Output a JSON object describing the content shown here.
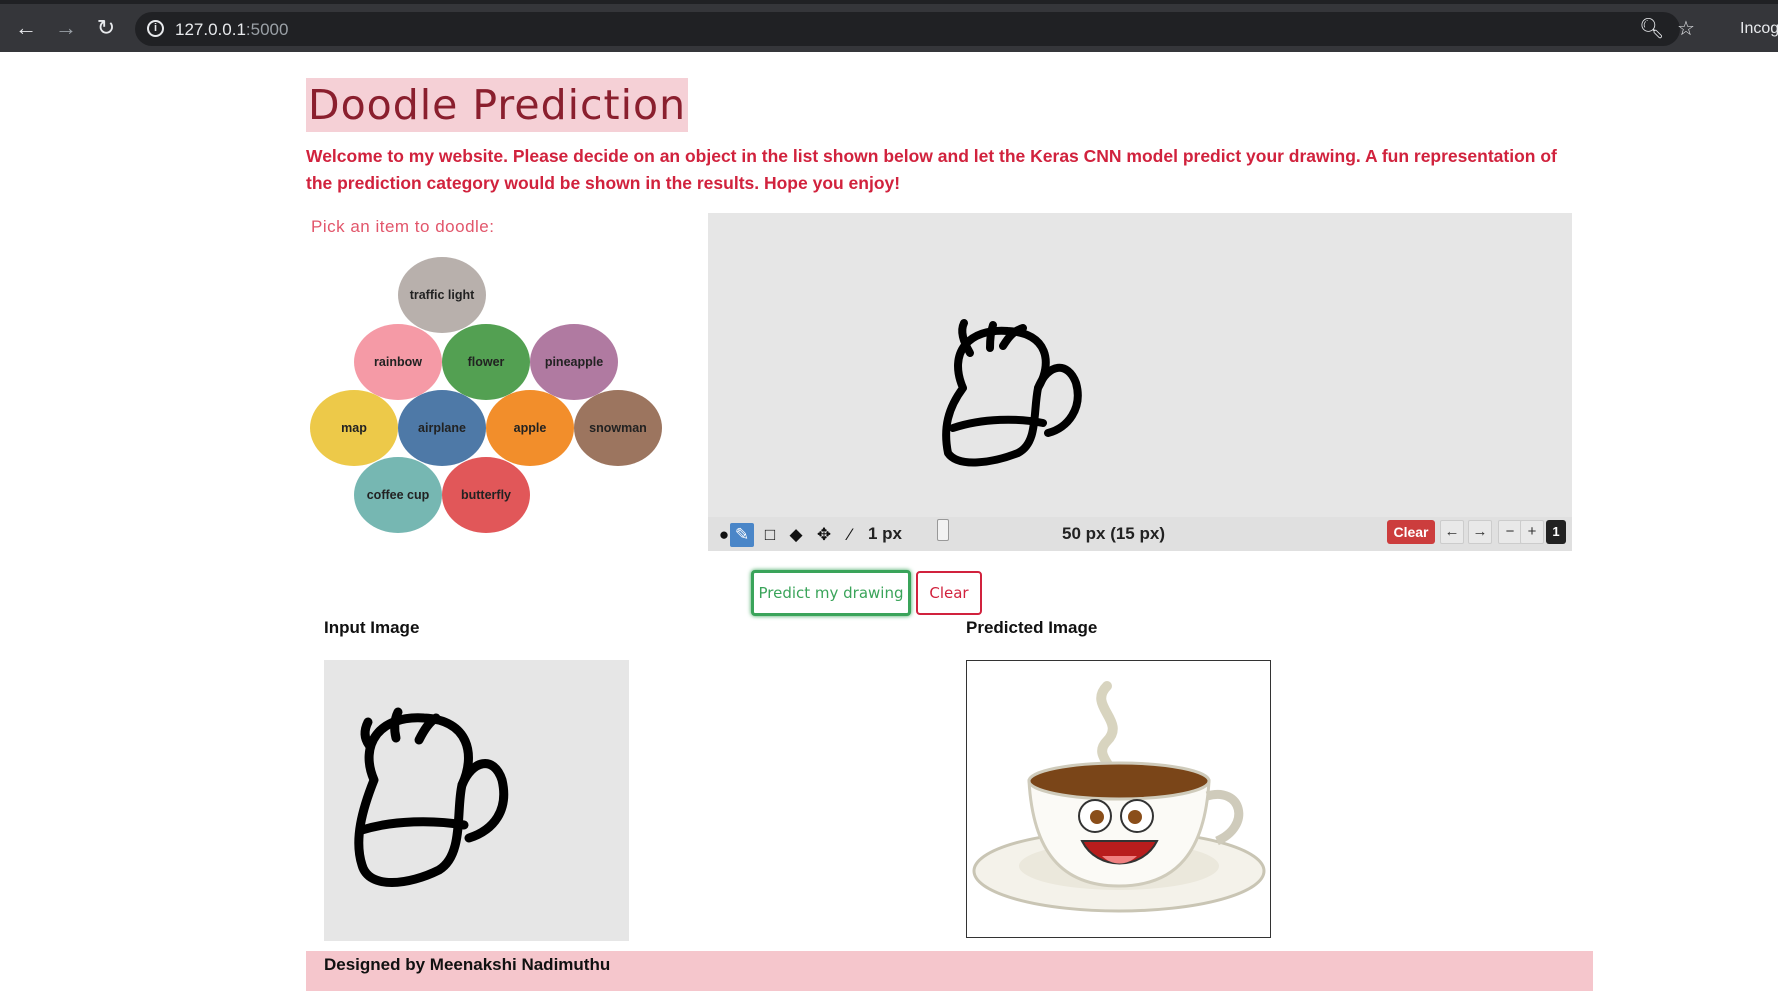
{
  "browser": {
    "url_host": "127.0.0.1",
    "url_port": ":5000",
    "incognito_label": "Incog"
  },
  "page": {
    "title": "Doodle Prediction",
    "welcome": "Welcome to my website. Please decide on an object in the list shown below and let the Keras CNN model predict your drawing. A fun representation of the prediction category would be shown in the results. Hope you enjoy!",
    "pick_label": "Pick an item to doodle:"
  },
  "items": [
    {
      "label": "traffic light",
      "color": "#b8b0ac"
    },
    {
      "label": "rainbow",
      "color": "#f59aa6"
    },
    {
      "label": "flower",
      "color": "#53a052"
    },
    {
      "label": "pineapple",
      "color": "#b07aa1"
    },
    {
      "label": "map",
      "color": "#edc949"
    },
    {
      "label": "airplane",
      "color": "#4e79a7"
    },
    {
      "label": "apple",
      "color": "#f28e2b"
    },
    {
      "label": "snowman",
      "color": "#9c755f"
    },
    {
      "label": "coffee cup",
      "color": "#76b7b2"
    },
    {
      "label": "butterfly",
      "color": "#e15759"
    }
  ],
  "toolbar": {
    "brush_size": "1 px",
    "size_readout": "50 px (15 px)",
    "clear_label": "Clear",
    "undo_label": "←",
    "redo_label": "→",
    "zoom_out_label": "−",
    "zoom_in_label": "+",
    "page_number": "1"
  },
  "actions": {
    "predict_label": "Predict my drawing",
    "clear_label": "Clear"
  },
  "results": {
    "input_label": "Input Image",
    "predicted_label": "Predicted Image"
  },
  "footer": {
    "credit": "Designed by Meenakshi Nadimuthu"
  }
}
